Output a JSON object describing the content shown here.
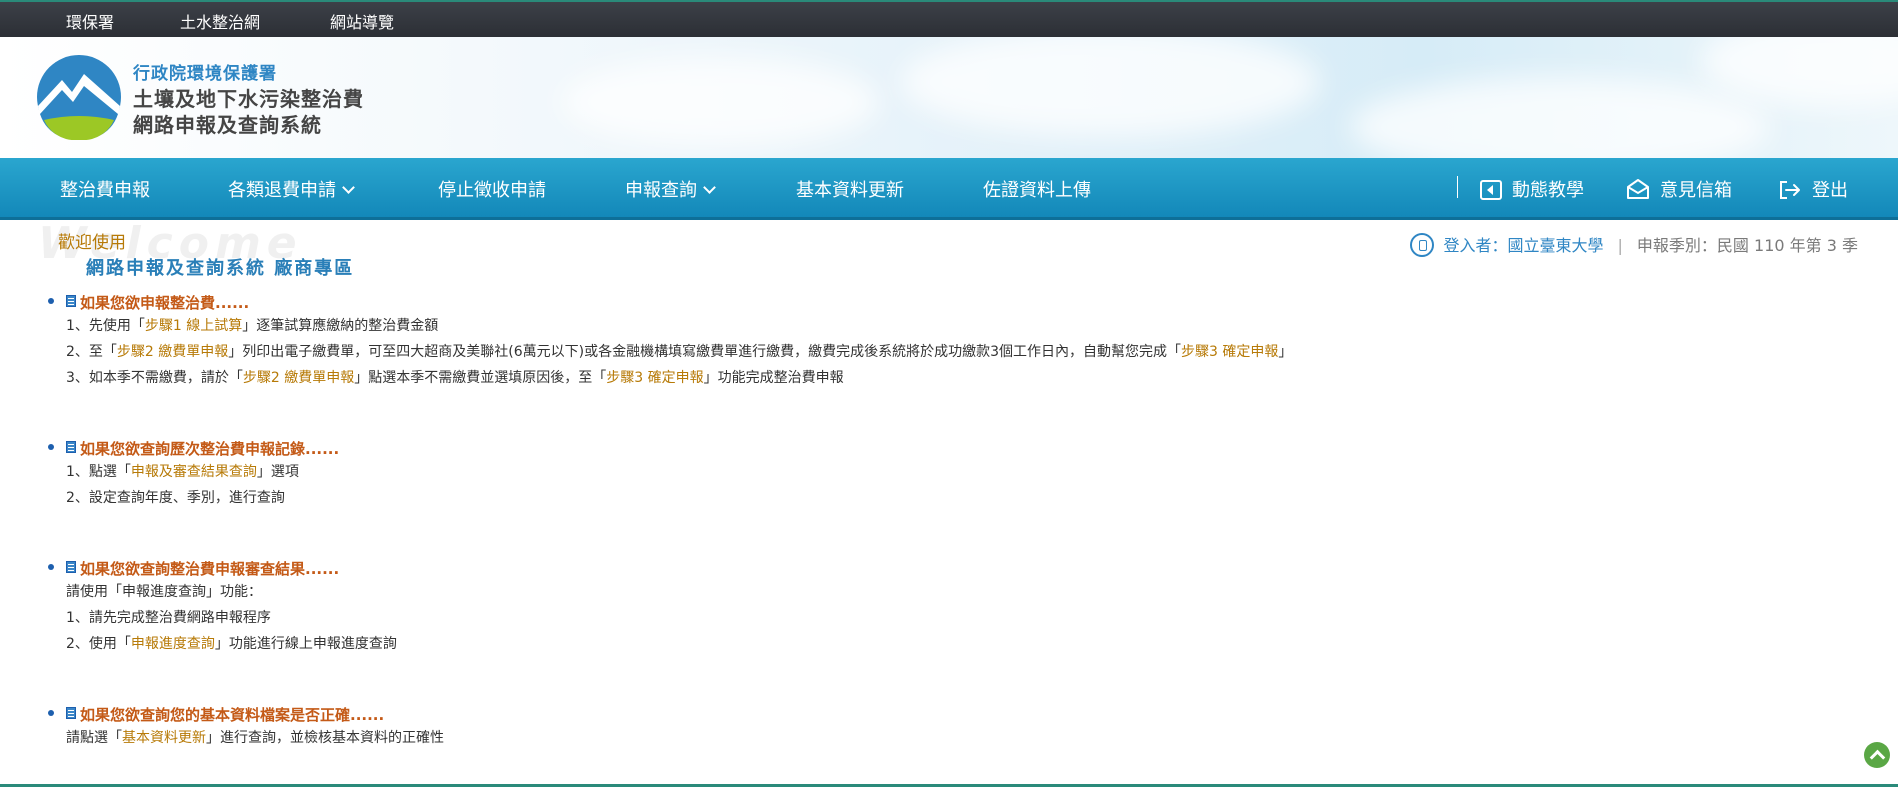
{
  "topbar": {
    "links": [
      "環保署",
      "土水整治網",
      "網站導覽"
    ]
  },
  "brand": {
    "line1": "行政院環境保護署",
    "line2": "土壤及地下水污染整治費",
    "line3": "網路申報及查詢系統"
  },
  "nav": {
    "items": [
      "整治費申報",
      "各類退費申請",
      "停止徵收申請",
      "申報查詢",
      "基本資料更新",
      "佐證資料上傳"
    ],
    "right": [
      "動態教學",
      "意見信箱",
      "登出"
    ]
  },
  "welcome": {
    "bg": "Welcome",
    "title": "歡迎使用",
    "subtitle": "網路申報及查詢系統  廠商專區"
  },
  "user": {
    "label": "登入者：",
    "name": "國立臺東大學",
    "separator": "|",
    "season": "申報季別：民國 110 年第 3 季"
  },
  "sections": [
    {
      "title": "如果您欲申報整治費......",
      "lines": [
        [
          "1、先使用「",
          "步驟1 線上試算",
          "」逐筆試算應繳納的整治費金額"
        ],
        [
          "2、至「",
          "步驟2 繳費單申報",
          "」列印出電子繳費單，可至四大超商及美聯社(6萬元以下)或各金融機構填寫繳費單進行繳費，繳費完成後系統將於成功繳款3個工作日內，自動幫您完成「",
          "步驟3 確定申報",
          "」"
        ],
        [
          "3、如本季不需繳費，請於「",
          "步驟2 繳費單申報",
          "」點選本季不需繳費並選填原因後，至「",
          "步驟3 確定申報",
          "」功能完成整治費申報"
        ]
      ]
    },
    {
      "title": "如果您欲查詢歷次整治費申報記錄......",
      "lines": [
        [
          "1、點選「",
          "申報及審查結果查詢",
          "」選項"
        ],
        [
          "2、設定查詢年度、季別，進行查詢"
        ]
      ]
    },
    {
      "title": "如果您欲查詢整治費申報審查結果......",
      "lines": [
        [
          "請使用「申報進度查詢」功能："
        ],
        [
          "1、請先完成整治費網路申報程序"
        ],
        [
          "2、使用「",
          "申報進度查詢",
          "」功能進行線上申報進度查詢"
        ]
      ]
    },
    {
      "title": "如果您欲查詢您的基本資料檔案是否正確......",
      "lines": [
        [
          "請點選「",
          "基本資料更新",
          "」進行查詢，並檢核基本資料的正確性"
        ]
      ]
    }
  ],
  "colors": {
    "nav": "#1a94c4",
    "highlight": "#b77a07",
    "section_title": "#c45a17",
    "brand_blue": "#2f86c4"
  }
}
